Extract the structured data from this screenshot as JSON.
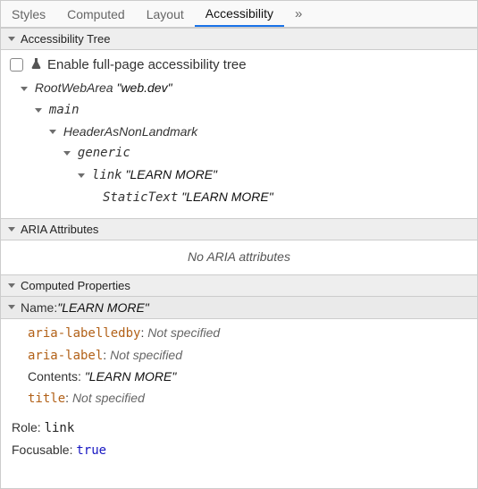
{
  "tabs": {
    "items": [
      "Styles",
      "Computed",
      "Layout",
      "Accessibility"
    ],
    "active_index": 3,
    "overflow_glyph": "»"
  },
  "sections": {
    "tree_header": "Accessibility Tree",
    "aria_header": "ARIA Attributes",
    "computed_header": "Computed Properties"
  },
  "enable_checkbox": {
    "label": "Enable full-page accessibility tree",
    "checked": false
  },
  "tree": {
    "n0": {
      "role": "RootWebArea",
      "name": "\"web.dev\""
    },
    "n1": {
      "role": "main"
    },
    "n2": {
      "role": "HeaderAsNonLandmark"
    },
    "n3": {
      "role": "generic"
    },
    "n4": {
      "role": "link",
      "name": "\"LEARN MORE\""
    },
    "n5": {
      "role": "StaticText",
      "name": "\"LEARN MORE\""
    }
  },
  "aria_empty": "No ARIA attributes",
  "computed": {
    "name_label": "Name: ",
    "name_value": "\"LEARN MORE\"",
    "rows": {
      "aria_labelledby": {
        "attr": "aria-labelledby",
        "sep": ": ",
        "value": "Not specified"
      },
      "aria_label": {
        "attr": "aria-label",
        "sep": ": ",
        "value": "Not specified"
      },
      "contents": {
        "attr": "Contents",
        "sep": ": ",
        "value": "\"LEARN MORE\""
      },
      "title": {
        "attr": "title",
        "sep": ": ",
        "value": "Not specified"
      }
    },
    "role": {
      "label": "Role: ",
      "value": "link"
    },
    "focusable": {
      "label": "Focusable: ",
      "value": "true"
    }
  }
}
